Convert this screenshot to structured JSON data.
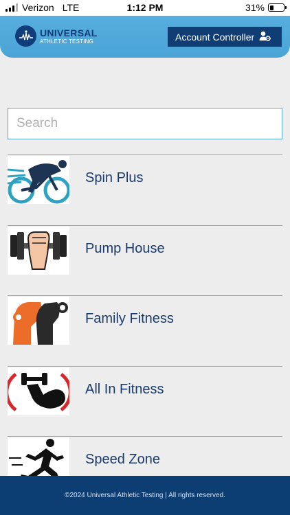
{
  "status_bar": {
    "carrier": "Verizon",
    "network": "LTE",
    "time": "1:12 PM",
    "battery_percent_label": "31%",
    "battery_level": 0.31
  },
  "header": {
    "logo_title": "UNIVERSAL",
    "logo_subtitle": "ATHLETIC TESTING",
    "account_button_label": "Account Controller",
    "colors": {
      "header_bg": "#56aede",
      "brand_navy": "#0f3d74"
    }
  },
  "search": {
    "placeholder": "Search",
    "value": ""
  },
  "gyms": [
    {
      "name": "Spin Plus",
      "icon": "cyclist-icon"
    },
    {
      "name": "Pump House",
      "icon": "fist-dumbbell-icon"
    },
    {
      "name": "Family Fitness",
      "icon": "bodybuilder-icon"
    },
    {
      "name": "All In Fitness",
      "icon": "flexed-arm-dumbbell-icon"
    },
    {
      "name": "Speed Zone",
      "icon": "runner-icon"
    }
  ],
  "footer": {
    "text": "©2024 Universal Athletic Testing | All rights reserved."
  }
}
